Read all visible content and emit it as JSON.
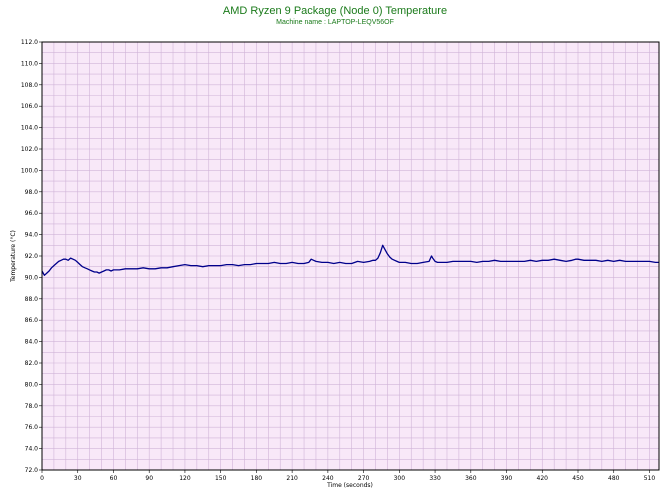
{
  "chart_data": {
    "type": "line",
    "title": "AMD Ryzen 9 Package (Node 0) Temperature",
    "subtitle": "Machine name : LAPTOP-LEQV56OF",
    "xlabel": "Time (seconds)",
    "ylabel": "Temperature (°C)",
    "xlim": [
      0,
      518
    ],
    "ylim": [
      72,
      112
    ],
    "x_ticks": [
      0,
      30,
      60,
      90,
      120,
      150,
      180,
      210,
      240,
      270,
      300,
      330,
      360,
      390,
      420,
      450,
      480,
      510
    ],
    "y_ticks": [
      72.0,
      74.0,
      76.0,
      78.0,
      80.0,
      82.0,
      84.0,
      86.0,
      88.0,
      90.0,
      92.0,
      94.0,
      96.0,
      98.0,
      100.0,
      102.0,
      104.0,
      106.0,
      108.0,
      110.0,
      112.0
    ],
    "grid": true,
    "background_color": "#f8e8f8",
    "grid_color": "#d0b4d8",
    "line_color": "#00008b",
    "title_color": "#1a7a1a",
    "series": [
      {
        "x": [
          0,
          2,
          4,
          6,
          8,
          10,
          12,
          14,
          16,
          18,
          20,
          22,
          24,
          26,
          28,
          30,
          32,
          34,
          36,
          38,
          40,
          42,
          44,
          46,
          48,
          50,
          52,
          54,
          56,
          58,
          60,
          65,
          70,
          75,
          80,
          85,
          90,
          95,
          100,
          105,
          110,
          115,
          120,
          125,
          130,
          135,
          140,
          145,
          150,
          155,
          160,
          165,
          170,
          175,
          180,
          185,
          190,
          195,
          200,
          205,
          210,
          215,
          220,
          224,
          226,
          228,
          230,
          235,
          240,
          245,
          250,
          255,
          260,
          265,
          270,
          275,
          278,
          280,
          282,
          284,
          286,
          288,
          290,
          292,
          294,
          296,
          298,
          300,
          305,
          310,
          315,
          320,
          325,
          327,
          328,
          330,
          332,
          335,
          340,
          345,
          350,
          355,
          360,
          365,
          370,
          375,
          380,
          385,
          390,
          395,
          400,
          405,
          410,
          415,
          420,
          425,
          430,
          435,
          440,
          445,
          448,
          450,
          455,
          460,
          465,
          470,
          475,
          480,
          485,
          490,
          495,
          500,
          505,
          510,
          515,
          518
        ],
        "values": [
          90.6,
          90.2,
          90.4,
          90.6,
          90.9,
          91.1,
          91.3,
          91.5,
          91.6,
          91.7,
          91.7,
          91.6,
          91.8,
          91.7,
          91.6,
          91.4,
          91.2,
          91.0,
          90.9,
          90.8,
          90.7,
          90.6,
          90.5,
          90.5,
          90.4,
          90.5,
          90.6,
          90.7,
          90.7,
          90.6,
          90.7,
          90.7,
          90.8,
          90.8,
          90.8,
          90.9,
          90.8,
          90.8,
          90.9,
          90.9,
          91.0,
          91.1,
          91.2,
          91.1,
          91.1,
          91.0,
          91.1,
          91.1,
          91.1,
          91.2,
          91.2,
          91.1,
          91.2,
          91.2,
          91.3,
          91.3,
          91.3,
          91.4,
          91.3,
          91.3,
          91.4,
          91.3,
          91.3,
          91.4,
          91.7,
          91.6,
          91.5,
          91.4,
          91.4,
          91.3,
          91.4,
          91.3,
          91.3,
          91.5,
          91.4,
          91.5,
          91.6,
          91.6,
          91.8,
          92.3,
          93.0,
          92.6,
          92.2,
          91.9,
          91.7,
          91.6,
          91.5,
          91.4,
          91.4,
          91.3,
          91.3,
          91.4,
          91.5,
          92.0,
          91.8,
          91.5,
          91.4,
          91.4,
          91.4,
          91.5,
          91.5,
          91.5,
          91.5,
          91.4,
          91.5,
          91.5,
          91.6,
          91.5,
          91.5,
          91.5,
          91.5,
          91.5,
          91.6,
          91.5,
          91.6,
          91.6,
          91.7,
          91.6,
          91.5,
          91.6,
          91.7,
          91.7,
          91.6,
          91.6,
          91.6,
          91.5,
          91.6,
          91.5,
          91.6,
          91.5,
          91.5,
          91.5,
          91.5,
          91.5,
          91.4,
          91.4
        ]
      }
    ]
  }
}
